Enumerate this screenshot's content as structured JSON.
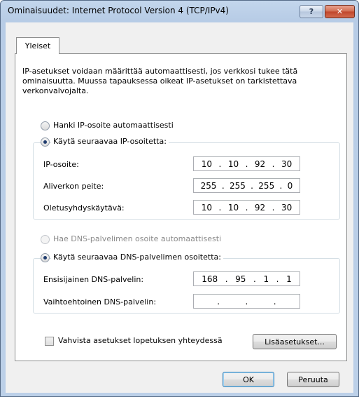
{
  "window": {
    "title": "Ominaisuudet: Internet Protocol Version 4 (TCP/IPv4)",
    "help_label": "?",
    "close_label": "✕"
  },
  "tab": {
    "label": "Yleiset"
  },
  "intro": {
    "line1": "IP-asetukset voidaan määrittää automaattisesti, jos verkkosi tukee tätä",
    "line2": "ominaisuutta. Muussa tapauksessa oikeat IP-asetukset on tarkistettava",
    "line3": "verkonvalvojalta."
  },
  "ip": {
    "auto_label": "Hanki IP-osoite automaattisesti",
    "manual_label": "Käytä seuraavaa IP-osoitetta:",
    "address_label": "IP-osoite:",
    "address": [
      "10",
      "10",
      "92",
      "30"
    ],
    "subnet_label": "Aliverkon peite:",
    "subnet": [
      "255",
      "255",
      "255",
      "0"
    ],
    "gateway_label": "Oletusyhdyskäytävä:",
    "gateway": [
      "10",
      "10",
      "92",
      "30"
    ]
  },
  "dns": {
    "auto_label": "Hae DNS-palvelimen osoite automaattisesti",
    "manual_label": "Käytä seuraavaa DNS-palvelimen osoitetta:",
    "primary_label": "Ensisijainen DNS-palvelin:",
    "primary": [
      "168",
      "95",
      "1",
      "1"
    ],
    "alternate_label": "Vaihtoehtoinen DNS-palvelin:",
    "alternate": [
      "",
      "",
      "",
      ""
    ]
  },
  "validate_label": "Vahvista asetukset lopetuksen yhteydessä",
  "advanced_label": "Lisäasetukset...",
  "ok_label": "OK",
  "cancel_label": "Peruuta",
  "dot": "."
}
